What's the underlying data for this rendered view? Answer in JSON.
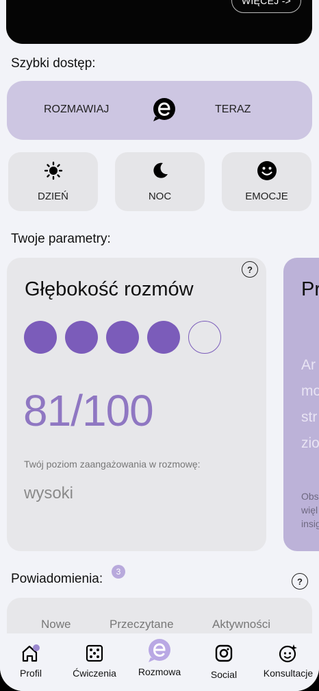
{
  "header": {
    "more_label": "WIĘCEJ ->"
  },
  "quick_access": {
    "title": "Szybki dostęp:",
    "talk_left": "ROZMAWIAJ",
    "talk_right": "TERAZ",
    "buttons": [
      {
        "label": "DZIEŃ",
        "icon": "sun-icon"
      },
      {
        "label": "NOC",
        "icon": "moon-icon"
      },
      {
        "label": "EMOCJE",
        "icon": "smiley-icon"
      }
    ]
  },
  "parameters": {
    "title": "Twoje parametry:",
    "card": {
      "title": "Głębokość rozmów",
      "filled_dots": 4,
      "total_dots": 5,
      "score": "81/100",
      "level_label": "Twój poziom zaangażowania w rozmowę:",
      "level_value": "wysoki"
    },
    "next_card": {
      "title": "Pr",
      "body": "Ar\nmo\nstr\nzio",
      "footer": "Obs\nwięl\ninsig"
    }
  },
  "notifications": {
    "title": "Powiadomienia:",
    "badge": "3",
    "tabs": [
      "Nowe",
      "Przeczytane",
      "Aktywności"
    ]
  },
  "bottom_nav": [
    {
      "label": "Profil",
      "icon": "home-icon"
    },
    {
      "label": "Ćwiczenia",
      "icon": "dice-icon"
    },
    {
      "label": "Rozmowa",
      "icon": "e-logo-icon"
    },
    {
      "label": "Social",
      "icon": "instagram-icon"
    },
    {
      "label": "Konsultacje",
      "icon": "sparkle-face-icon"
    }
  ],
  "colors": {
    "accent": "#7b5cba",
    "card_purple": "#cdc6e2",
    "background": "#f2f3f8"
  }
}
